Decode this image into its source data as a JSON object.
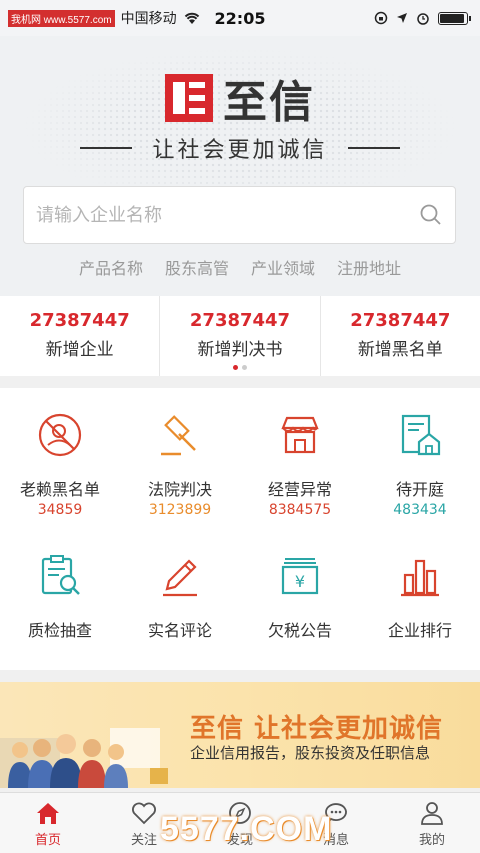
{
  "status_bar": {
    "watermark": "我机网 www.5577.com",
    "carrier": "中国移动",
    "time": "22:05"
  },
  "header": {
    "logo_text": "至信",
    "slogan": "让社会更加诚信",
    "search_placeholder": "请输入企业名称",
    "quick_filters": [
      "产品名称",
      "股东高管",
      "产业领域",
      "注册地址"
    ]
  },
  "stats": [
    {
      "value": "27387447",
      "label": "新增企业"
    },
    {
      "value": "27387447",
      "label": "新增判决书"
    },
    {
      "value": "27387447",
      "label": "新增黑名单"
    }
  ],
  "grid": [
    {
      "icon": "blacklist-icon",
      "label": "老赖黑名单",
      "count": "34859",
      "color": "#d8442e"
    },
    {
      "icon": "gavel-icon",
      "label": "法院判决",
      "count": "3123899",
      "color": "#e98c2c"
    },
    {
      "icon": "shop-icon",
      "label": "经营异常",
      "count": "8384575",
      "color": "#d8442e"
    },
    {
      "icon": "court-icon",
      "label": "待开庭",
      "count": "483434",
      "color": "#2aa6a6"
    },
    {
      "icon": "inspection-icon",
      "label": "质检抽查",
      "count": "",
      "color": "#2aa6a6"
    },
    {
      "icon": "pencil-icon",
      "label": "实名评论",
      "count": "",
      "color": "#d8442e"
    },
    {
      "icon": "tax-icon",
      "label": "欠税公告",
      "count": "",
      "color": "#2aa6a6"
    },
    {
      "icon": "ranking-icon",
      "label": "企业排行",
      "count": "",
      "color": "#d8442e"
    }
  ],
  "banner": {
    "title": "至信 让社会更加诚信",
    "subtitle": "企业信用报告，股东投资及任职信息"
  },
  "tabbar": [
    {
      "icon": "home-icon",
      "label": "首页",
      "active": true
    },
    {
      "icon": "heart-icon",
      "label": "关注",
      "active": false
    },
    {
      "icon": "compass-icon",
      "label": "发现",
      "active": false
    },
    {
      "icon": "message-icon",
      "label": "消息",
      "active": false
    },
    {
      "icon": "user-icon",
      "label": "我的",
      "active": false
    }
  ],
  "watermark_bottom": "5577.COM",
  "colors": {
    "brand_red": "#d8282d",
    "orange": "#e98c2c",
    "teal": "#2aa6a6"
  }
}
